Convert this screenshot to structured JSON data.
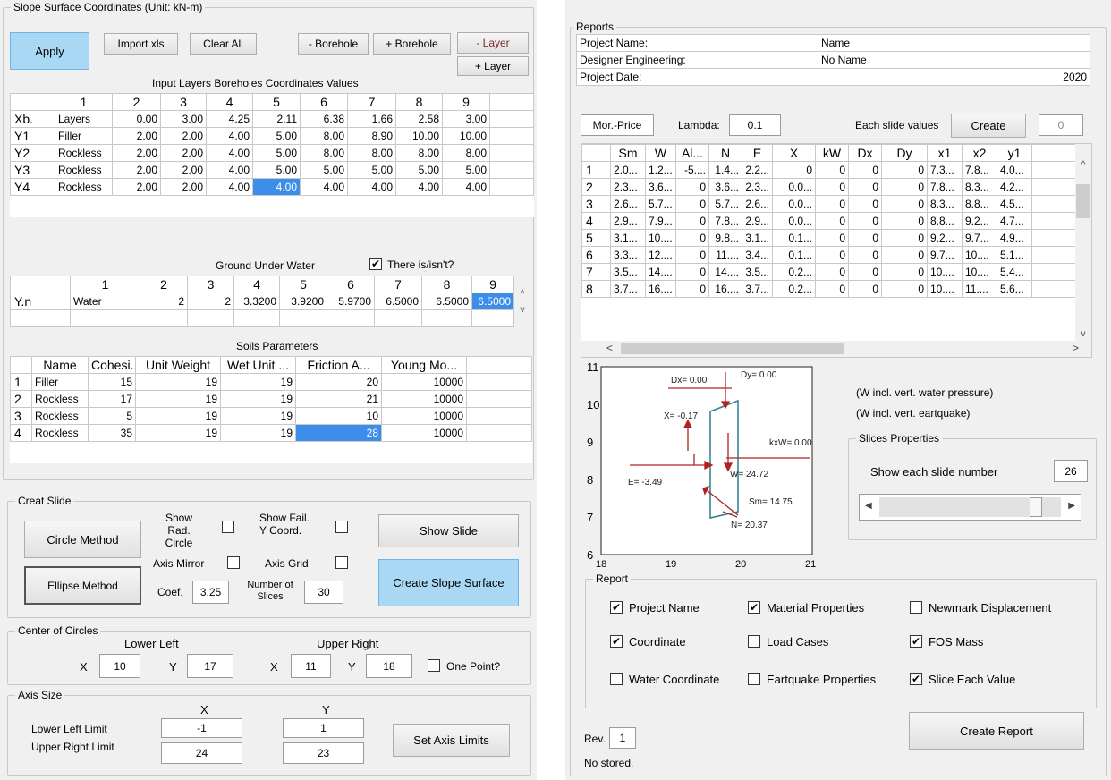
{
  "left": {
    "title": "Slope Surface Coordinates (Unit: kN-m)",
    "apply": "Apply",
    "import": "Import xls",
    "clear": "Clear All",
    "minus_borehole": "- Borehole",
    "plus_borehole": "+ Borehole",
    "minus_layer": "- Layer",
    "plus_layer": "+ Layer",
    "coord_title": "Input Layers Boreholes Coordinates Values",
    "coord_cols": [
      "1",
      "2",
      "3",
      "4",
      "5",
      "6",
      "7",
      "8",
      "9"
    ],
    "coord_rows": [
      {
        "h": "Xb.",
        "c": [
          "Layers",
          "0.00",
          "3.00",
          "4.25",
          "2.11",
          "6.38",
          "1.66",
          "2.58",
          "3.00"
        ]
      },
      {
        "h": "Y1",
        "c": [
          "Filler",
          "2.00",
          "2.00",
          "4.00",
          "5.00",
          "8.00",
          "8.90",
          "10.00",
          "10.00"
        ]
      },
      {
        "h": "Y2",
        "c": [
          "Rockless",
          "2.00",
          "2.00",
          "4.00",
          "5.00",
          "8.00",
          "8.00",
          "8.00",
          "8.00"
        ]
      },
      {
        "h": "Y3",
        "c": [
          "Rockless",
          "2.00",
          "2.00",
          "4.00",
          "5.00",
          "5.00",
          "5.00",
          "5.00",
          "5.00"
        ]
      },
      {
        "h": "Y4",
        "c": [
          "Rockless",
          "2.00",
          "2.00",
          "4.00",
          "4.00",
          "4.00",
          "4.00",
          "4.00",
          "4.00"
        ]
      }
    ],
    "water_title": "Ground Under Water",
    "water_check": "There is/isn't?",
    "water_cols": [
      "1",
      "2",
      "3",
      "4",
      "5",
      "6",
      "7",
      "8",
      "9"
    ],
    "water_row": {
      "h": "Y.n",
      "c": [
        "Water",
        "2",
        "2",
        "3.3200",
        "3.9200",
        "5.9700",
        "6.5000",
        "6.5000",
        "6.5000"
      ]
    },
    "soil_title": "Soils Parameters",
    "soil_cols": [
      "Name",
      "Cohesi...",
      "Unit Weight",
      "Wet Unit ...",
      "Friction A...",
      "Young Mo..."
    ],
    "soil_rows": [
      {
        "h": "1",
        "c": [
          "Filler",
          "15",
          "19",
          "19",
          "20",
          "10000"
        ]
      },
      {
        "h": "2",
        "c": [
          "Rockless",
          "17",
          "19",
          "19",
          "21",
          "10000"
        ]
      },
      {
        "h": "3",
        "c": [
          "Rockless",
          "5",
          "19",
          "19",
          "10",
          "10000"
        ]
      },
      {
        "h": "4",
        "c": [
          "Rockless",
          "35",
          "19",
          "19",
          "28",
          "10000"
        ]
      }
    ],
    "slide": {
      "title": "Creat Slide",
      "circle": "Circle Method",
      "ellipse": "Ellipse Method",
      "show_rad": "Show Rad. Circle",
      "show_fail": "Show Fail. Y Coord.",
      "axis_mirror": "Axis Mirror",
      "axis_grid": "Axis Grid",
      "coef_label": "Coef.",
      "coef": "3.25",
      "nslices_label": "Number of Slices",
      "nslices": "30",
      "show_slide": "Show Slide",
      "create_surface": "Create Slope Surface"
    },
    "centers": {
      "title": "Center of Circles",
      "lower_left": "Lower Left",
      "upper_right": "Upper Right",
      "x": "X",
      "y": "Y",
      "ll_x": "10",
      "ll_y": "17",
      "ur_x": "11",
      "ur_y": "18",
      "one_point": "One Point?"
    },
    "axis": {
      "title": "Axis Size",
      "x": "X",
      "y": "Y",
      "lower": "Lower Left Limit",
      "upper": "Upper Right Limit",
      "ll_x": "-1",
      "ll_y": "1",
      "ur_x": "24",
      "ur_y": "23",
      "set": "Set Axis Limits"
    }
  },
  "right": {
    "title": "Reports",
    "info": [
      [
        "Project Name:",
        "Name",
        ""
      ],
      [
        "Designer Engineering:",
        "No Name",
        ""
      ],
      [
        "Project Date:",
        "",
        "2020"
      ]
    ],
    "method": "Mor.-Price",
    "lambda_label": "Lambda:",
    "lambda": "0.1",
    "each_label": "Each slide values",
    "create": "Create",
    "count": "0",
    "slice_cols": [
      "Sm",
      "W",
      "Al...",
      "N",
      "E",
      "X",
      "kW",
      "Dx",
      "Dy",
      "x1",
      "x2",
      "y1"
    ],
    "slice_rows": [
      {
        "h": "1",
        "c": [
          "2.0...",
          "1.2...",
          "-5....",
          "1.4...",
          "2.2...",
          "0",
          "0",
          "0",
          "0",
          "7.3...",
          "7.8...",
          "4.0..."
        ]
      },
      {
        "h": "2",
        "c": [
          "2.3...",
          "3.6...",
          "0",
          "3.6...",
          "2.3...",
          "0.0...",
          "0",
          "0",
          "0",
          "7.8...",
          "8.3...",
          "4.2..."
        ]
      },
      {
        "h": "3",
        "c": [
          "2.6...",
          "5.7...",
          "0",
          "5.7...",
          "2.6...",
          "0.0...",
          "0",
          "0",
          "0",
          "8.3...",
          "8.8...",
          "4.5..."
        ]
      },
      {
        "h": "4",
        "c": [
          "2.9...",
          "7.9...",
          "0",
          "7.8...",
          "2.9...",
          "0.0...",
          "0",
          "0",
          "0",
          "8.8...",
          "9.2...",
          "4.7..."
        ]
      },
      {
        "h": "5",
        "c": [
          "3.1...",
          "10....",
          "0",
          "9.8...",
          "3.1...",
          "0.1...",
          "0",
          "0",
          "0",
          "9.2...",
          "9.7...",
          "4.9..."
        ]
      },
      {
        "h": "6",
        "c": [
          "3.3...",
          "12....",
          "0",
          "11....",
          "3.4...",
          "0.1...",
          "0",
          "0",
          "0",
          "9.7...",
          "10....",
          "5.1..."
        ]
      },
      {
        "h": "7",
        "c": [
          "3.5...",
          "14....",
          "0",
          "14....",
          "3.5...",
          "0.2...",
          "0",
          "0",
          "0",
          "10....",
          "10....",
          "5.4..."
        ]
      },
      {
        "h": "8",
        "c": [
          "3.7...",
          "16....",
          "0",
          "16....",
          "3.7...",
          "0.2...",
          "0",
          "0",
          "0",
          "10....",
          "11....",
          "5.6..."
        ]
      }
    ],
    "plot": {
      "y_ticks": [
        "11",
        "10",
        "9",
        "8",
        "7",
        "6"
      ],
      "x_ticks": [
        "18",
        "19",
        "20",
        "21"
      ],
      "labels": {
        "dx": "Dx= 0.00",
        "dy": "Dy= 0.00",
        "x": "X= -0.17",
        "kxw": "kxW= 0.00",
        "w": "W= 24.72",
        "e": "E= -3.49",
        "sm": "Sm= 14.75",
        "n": "N= 20.37"
      }
    },
    "notes": [
      "(W incl. vert. water pressure)",
      "(W incl. vert. eartquake)"
    ],
    "slices_props": {
      "title": "Slices Properties",
      "show_each": "Show each slide number",
      "value": "26",
      "slider_fraction": 0.88
    },
    "report": {
      "title": "Report",
      "items": [
        {
          "label": "Project Name",
          "checked": true
        },
        {
          "label": "Material Properties",
          "checked": true
        },
        {
          "label": "Newmark Displacement",
          "checked": false
        },
        {
          "label": "Coordinate",
          "checked": true
        },
        {
          "label": "Load Cases",
          "checked": false
        },
        {
          "label": "FOS Mass",
          "checked": true
        },
        {
          "label": "Water Coordinate",
          "checked": false
        },
        {
          "label": "Eartquake Properties",
          "checked": false
        },
        {
          "label": "Slice Each Value",
          "checked": true
        }
      ]
    },
    "rev_label": "Rev.",
    "rev": "1",
    "status": "No stored.",
    "create_report": "Create Report"
  },
  "colors": {
    "panel": "#f0f0f0",
    "selected": "#3d8ee8",
    "button_blue": "#a9d8f5",
    "arrow": "#b22222",
    "slice": "#2a7f8f"
  }
}
